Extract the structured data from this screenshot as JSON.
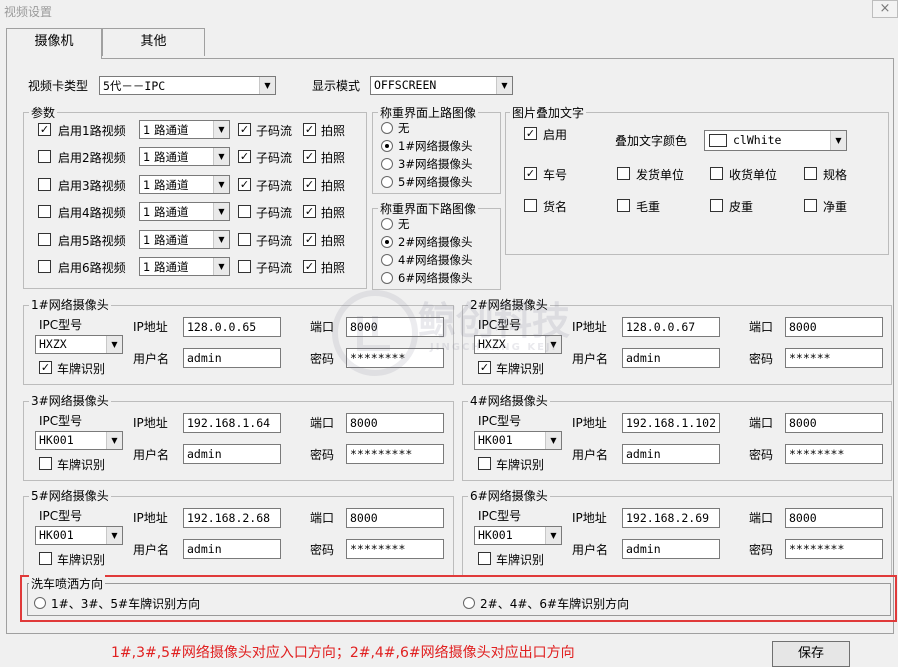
{
  "window": {
    "title": "视频设置",
    "close": "×"
  },
  "tabs": [
    {
      "label": "摄像机"
    },
    {
      "label": "其他"
    }
  ],
  "top": {
    "card_type_label": "视频卡类型",
    "card_type_value": "5代－－IPC",
    "display_mode_label": "显示模式",
    "display_mode_value": "OFFSCREEN"
  },
  "params": {
    "title": "参数",
    "rows": [
      {
        "enable_label": "启用1路视频",
        "enabled": true,
        "channel": "1 路通道",
        "substream_label": "子码流",
        "substream": true,
        "snapshot_label": "拍照",
        "snapshot": true
      },
      {
        "enable_label": "启用2路视频",
        "enabled": false,
        "channel": "1 路通道",
        "substream_label": "子码流",
        "substream": true,
        "snapshot_label": "拍照",
        "snapshot": true
      },
      {
        "enable_label": "启用3路视频",
        "enabled": false,
        "channel": "1 路通道",
        "substream_label": "子码流",
        "substream": true,
        "snapshot_label": "拍照",
        "snapshot": true
      },
      {
        "enable_label": "启用4路视频",
        "enabled": false,
        "channel": "1 路通道",
        "substream_label": "子码流",
        "substream": false,
        "snapshot_label": "拍照",
        "snapshot": true
      },
      {
        "enable_label": "启用5路视频",
        "enabled": false,
        "channel": "1 路通道",
        "substream_label": "子码流",
        "substream": false,
        "snapshot_label": "拍照",
        "snapshot": true
      },
      {
        "enable_label": "启用6路视频",
        "enabled": false,
        "channel": "1 路通道",
        "substream_label": "子码流",
        "substream": false,
        "snapshot_label": "拍照",
        "snapshot": true
      }
    ]
  },
  "upper_image": {
    "title": "称重界面上路图像",
    "options": [
      "无",
      "1#网络摄像头",
      "3#网络摄像头",
      "5#网络摄像头"
    ],
    "selected_index": 1
  },
  "lower_image": {
    "title": "称重界面下路图像",
    "options": [
      "无",
      "2#网络摄像头",
      "4#网络摄像头",
      "6#网络摄像头"
    ],
    "selected_index": 1
  },
  "overlay": {
    "title": "图片叠加文字",
    "enable_label": "启用",
    "enabled": true,
    "color_label": "叠加文字颜色",
    "color_value": "clWhite",
    "fields": [
      {
        "label": "车号",
        "checked": true
      },
      {
        "label": "发货单位",
        "checked": false
      },
      {
        "label": "收货单位",
        "checked": false
      },
      {
        "label": "规格",
        "checked": false
      },
      {
        "label": "货名",
        "checked": false
      },
      {
        "label": "毛重",
        "checked": false
      },
      {
        "label": "皮重",
        "checked": false
      },
      {
        "label": "净重",
        "checked": false
      }
    ]
  },
  "camera_labels": {
    "ipc_type": "IPC型号",
    "ip": "IP地址",
    "port": "端口",
    "user": "用户名",
    "password": "密码",
    "plate": "车牌识别"
  },
  "cameras": [
    {
      "title": "1#网络摄像头",
      "ipc": "HXZX",
      "ip": "128.0.0.65",
      "port": "8000",
      "user": "admin",
      "password": "********",
      "plate": true
    },
    {
      "title": "2#网络摄像头",
      "ipc": "HXZX",
      "ip": "128.0.0.67",
      "port": "8000",
      "user": "admin",
      "password": "******",
      "plate": true
    },
    {
      "title": "3#网络摄像头",
      "ipc": "HK001",
      "ip": "192.168.1.64",
      "port": "8000",
      "user": "admin",
      "password": "*********",
      "plate": false
    },
    {
      "title": "4#网络摄像头",
      "ipc": "HK001",
      "ip": "192.168.1.102",
      "port": "8000",
      "user": "admin",
      "password": "********",
      "plate": false
    },
    {
      "title": "5#网络摄像头",
      "ipc": "HK001",
      "ip": "192.168.2.68",
      "port": "8000",
      "user": "admin",
      "password": "********",
      "plate": false
    },
    {
      "title": "6#网络摄像头",
      "ipc": "HK001",
      "ip": "192.168.2.69",
      "port": "8000",
      "user": "admin",
      "password": "********",
      "plate": false
    }
  ],
  "wash": {
    "title": "洗车喷洒方向",
    "option1": "1#、3#、5#车牌识别方向",
    "option2": "2#、4#、6#车牌识别方向",
    "selected": null
  },
  "note": "1#,3#,5#网络摄像头对应入口方向；2#,4#,6#网络摄像头对应出口方向",
  "save_label": "保存",
  "watermark": {
    "cn": "鲸创科技",
    "en": "JINGCHUANG KEJI"
  }
}
